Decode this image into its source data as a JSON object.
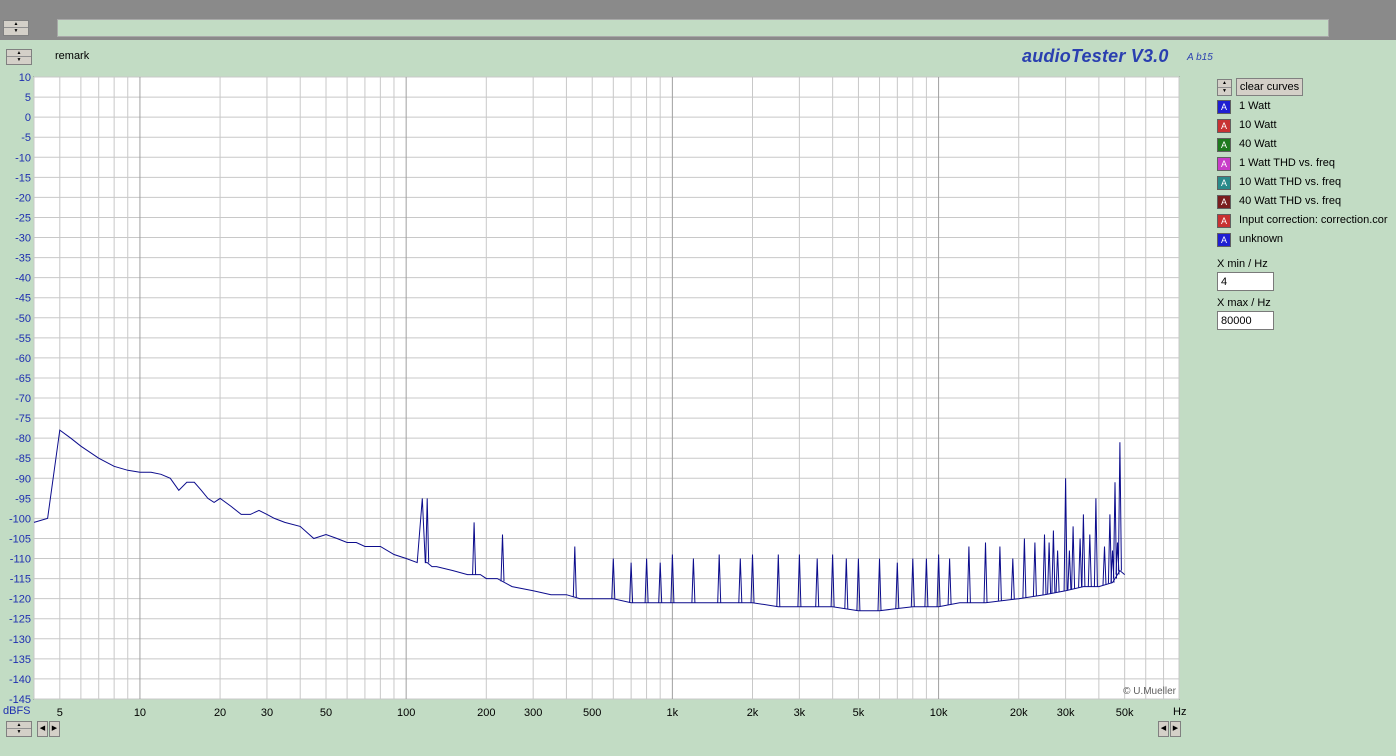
{
  "remark": "remark",
  "brand": {
    "title": "audioTester V3.0",
    "build": "A b15"
  },
  "copyright": "© U.Mueller",
  "controls": {
    "clear_label": "clear curves",
    "xmin_label": "X min / Hz",
    "xmin_value": "4",
    "xmax_label": "X max / Hz",
    "xmax_value": "80000"
  },
  "legend": [
    {
      "box_letter": "A",
      "label": "1 Watt",
      "color": "#1f1fd2"
    },
    {
      "box_letter": "A",
      "label": "10 Watt",
      "color": "#c83232"
    },
    {
      "box_letter": "A",
      "label": "40 Watt",
      "color": "#1e7a1e"
    },
    {
      "box_letter": "A",
      "label": "1 Watt THD vs. freq",
      "color": "#c83cc8"
    },
    {
      "box_letter": "A",
      "label": "10 Watt THD vs. freq",
      "color": "#2a8a8a"
    },
    {
      "box_letter": "A",
      "label": "40 Watt THD vs. freq",
      "color": "#7a1e1e"
    },
    {
      "box_letter": "A",
      "label": "Input correction: correction.cor",
      "color": "#c83232"
    },
    {
      "box_letter": "A",
      "label": "unknown",
      "color": "#1f1fd2"
    }
  ],
  "chart_data": {
    "type": "line",
    "x_scale": "log",
    "xlim": [
      4,
      80000
    ],
    "ylim": [
      -145,
      10
    ],
    "grid": true,
    "ylabel": "dBFS",
    "xlabel": "Hz",
    "line_color": "#0c0c8c",
    "ytick_labels": [
      "10",
      "5",
      "0",
      "-5",
      "-10",
      "-15",
      "-20",
      "-25",
      "-30",
      "-35",
      "-40",
      "-45",
      "-50",
      "-55",
      "-60",
      "-65",
      "-70",
      "-75",
      "-80",
      "-85",
      "-90",
      "-95",
      "-100",
      "-105",
      "-110",
      "-115",
      "-120",
      "-125",
      "-130",
      "-135",
      "-140",
      "-145"
    ],
    "xticks": [
      {
        "v": 5,
        "label": "5"
      },
      {
        "v": 10,
        "label": "10"
      },
      {
        "v": 20,
        "label": "20"
      },
      {
        "v": 30,
        "label": "30"
      },
      {
        "v": 50,
        "label": "50"
      },
      {
        "v": 100,
        "label": "100"
      },
      {
        "v": 200,
        "label": "200"
      },
      {
        "v": 300,
        "label": "300"
      },
      {
        "v": 500,
        "label": "500"
      },
      {
        "v": 1000,
        "label": "1k"
      },
      {
        "v": 2000,
        "label": "2k"
      },
      {
        "v": 3000,
        "label": "3k"
      },
      {
        "v": 5000,
        "label": "5k"
      },
      {
        "v": 10000,
        "label": "10k"
      },
      {
        "v": 20000,
        "label": "20k"
      },
      {
        "v": 30000,
        "label": "30k"
      },
      {
        "v": 50000,
        "label": "50k"
      }
    ],
    "series": [
      {
        "x": [
          4,
          4.5,
          5,
          5.5,
          6,
          7,
          8,
          9,
          10,
          11,
          12,
          13,
          14,
          15,
          16,
          17,
          18,
          19,
          20,
          22,
          24,
          26,
          28,
          30,
          32,
          35,
          40,
          45,
          50,
          55,
          60,
          65,
          70,
          80,
          90,
          100,
          110,
          115,
          118,
          120,
          125,
          130,
          150,
          170,
          190,
          200,
          220,
          250,
          300,
          350,
          400,
          450,
          500,
          600,
          700,
          800,
          1000,
          1200,
          1500,
          2000,
          2500,
          3000,
          4000,
          5000,
          6000,
          8000,
          10000,
          12000,
          15000,
          20000,
          25000,
          30000,
          35000,
          40000,
          45000,
          48000,
          50000
        ],
        "y": [
          -101,
          -100,
          -78,
          -80,
          -82,
          -85,
          -87,
          -88,
          -88.5,
          -88.5,
          -89,
          -90,
          -93,
          -91,
          -91,
          -93,
          -95,
          -96,
          -95,
          -97,
          -99,
          -99,
          -98,
          -99,
          -100,
          -101,
          -102,
          -105,
          -104,
          -105,
          -106,
          -106,
          -107,
          -107,
          -109,
          -110,
          -111,
          -95,
          -111,
          -111,
          -112,
          -112,
          -113,
          -114,
          -114,
          -115,
          -115,
          -117,
          -118,
          -119,
          -119,
          -120,
          -120,
          -120,
          -121,
          -121,
          -121,
          -121,
          -121,
          -121,
          -122,
          -122,
          -122,
          -123,
          -123,
          -122,
          -122,
          -121,
          -121,
          -120,
          -119,
          -118,
          -117,
          -117,
          -116,
          -113,
          -114
        ]
      },
      {
        "x": [
          120,
          180,
          230,
          430,
          600,
          700,
          800,
          900,
          1000,
          1200,
          1500,
          1800,
          2000,
          2500,
          3000,
          3500,
          4000,
          4500,
          5000,
          6000,
          7000,
          8000,
          9000,
          10000,
          11000,
          13000,
          15000,
          17000,
          19000,
          21000,
          23000,
          25000,
          26000,
          27000,
          28000,
          30000,
          31000,
          32000,
          34000,
          35000,
          37000,
          39000,
          42000,
          44000,
          45000,
          46000,
          47000,
          48000
        ],
        "y": [
          -95,
          -101,
          -104,
          -107,
          -110,
          -111,
          -110,
          -111,
          -109,
          -110,
          -109,
          -110,
          -109,
          -109,
          -109,
          -110,
          -109,
          -110,
          -110,
          -110,
          -111,
          -110,
          -110,
          -109,
          -110,
          -107,
          -106,
          -107,
          -110,
          -105,
          -106,
          -104,
          -106,
          -103,
          -108,
          -90,
          -108,
          -102,
          -105,
          -99,
          -104,
          -95,
          -107,
          -99,
          -108,
          -91,
          -106,
          -81
        ]
      }
    ]
  }
}
